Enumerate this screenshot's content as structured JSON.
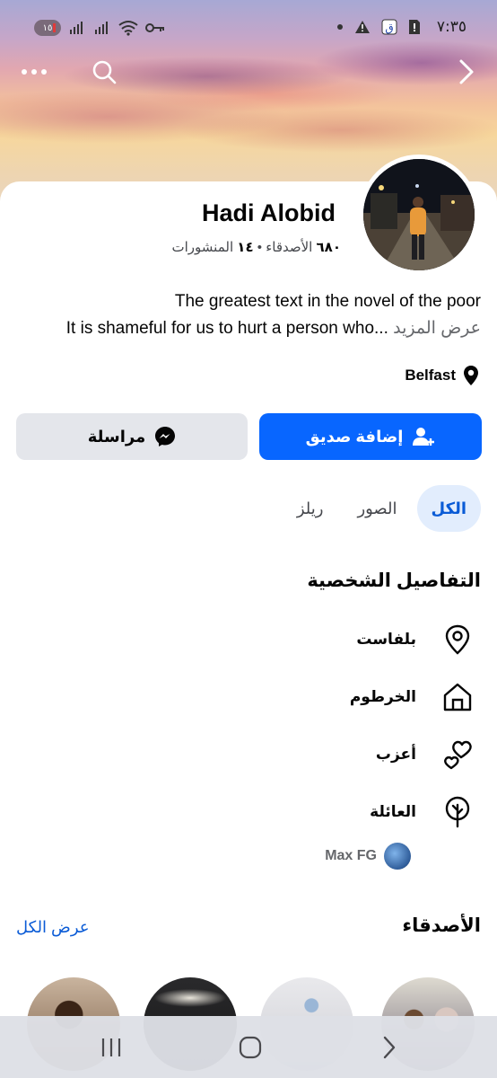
{
  "status_bar": {
    "time": "٧:٣٥",
    "battery": "١٥",
    "icons": [
      "battery-icon",
      "signal-icon",
      "signal-icon",
      "wifi-icon",
      "vpn-key-icon",
      "dot-icon",
      "warning-icon",
      "app-notification-icon",
      "sim-icon"
    ]
  },
  "header": {
    "back_icon": "chevron-right-icon",
    "search_icon": "search-icon",
    "more_icon": "more-icon"
  },
  "profile": {
    "name": "Hadi Alobid",
    "friends_count": "٦٨٠",
    "friends_label": "الأصدقاء",
    "separator": "•",
    "posts_count": "١٤",
    "posts_label": "المنشورات",
    "bio_line1": "The greatest text in the novel of the poor",
    "bio_line2": "It is shameful for us to hurt a person who...",
    "see_more": "عرض المزيد",
    "location": "Belfast"
  },
  "actions": {
    "add_friend": "إضافة صديق",
    "message": "مراسلة"
  },
  "tabs": [
    {
      "label": "الكل",
      "active": true
    },
    {
      "label": "الصور",
      "active": false
    },
    {
      "label": "ريلز",
      "active": false
    }
  ],
  "details": {
    "title": "التفاصيل الشخصية",
    "items": [
      {
        "label": "بلفاست",
        "icon": "location-pin-icon"
      },
      {
        "label": "الخرطوم",
        "icon": "home-icon"
      },
      {
        "label": "أعزب",
        "icon": "hearts-icon"
      },
      {
        "label": "العائلة",
        "icon": "tree-icon"
      }
    ],
    "family_member": "Max FG"
  },
  "friends": {
    "title": "الأصدقاء",
    "see_all": "عرض الكل"
  },
  "colors": {
    "accent": "#0866ff",
    "tab_active_bg": "#e2edfd",
    "tab_active_text": "#0a5bd6",
    "secondary_button": "#e4e6eb"
  }
}
